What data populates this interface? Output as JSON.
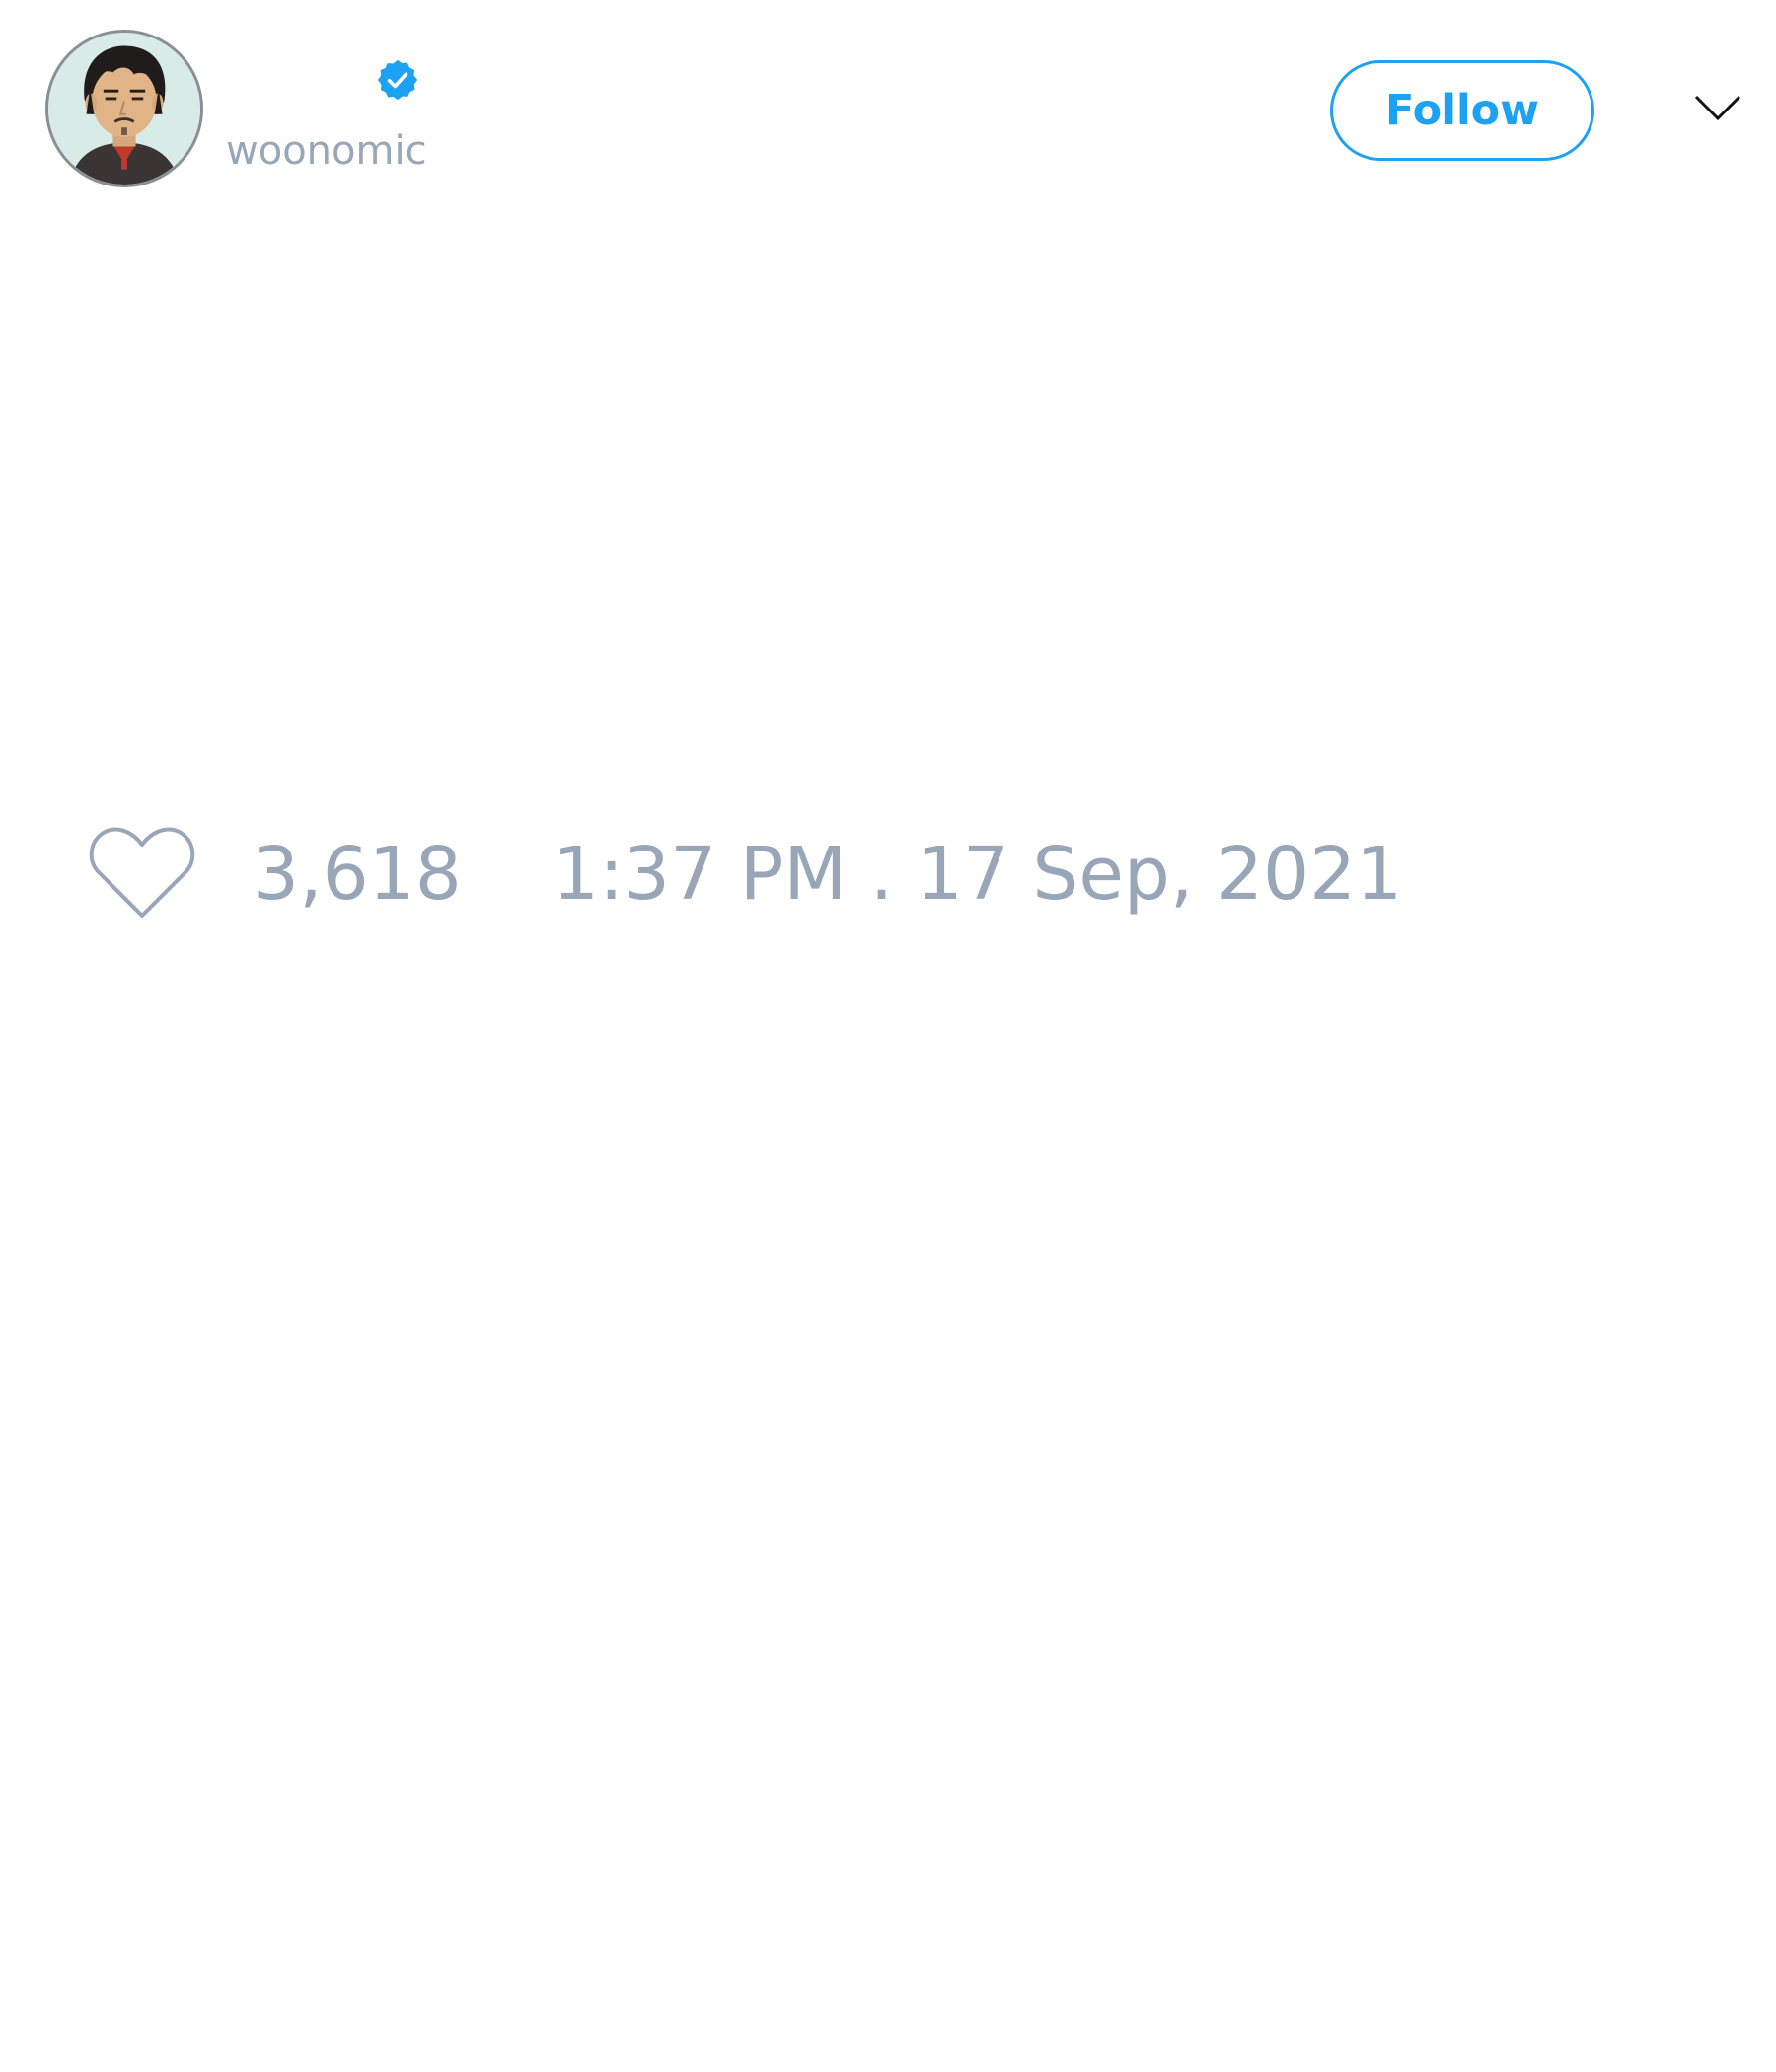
{
  "author": {
    "handle": "woonomic",
    "verified": true,
    "avatar_icon": "profile-avatar"
  },
  "actions": {
    "follow_label": "Follow",
    "menu_icon": "chevron-down-icon"
  },
  "stats": {
    "like_icon": "heart-icon",
    "like_count": "3,618",
    "timestamp": "1:37 PM . 17 Sep, 2021"
  },
  "colors": {
    "accent": "#1da1f2",
    "muted_text": "#98a6b8",
    "background": "#ffffff"
  }
}
